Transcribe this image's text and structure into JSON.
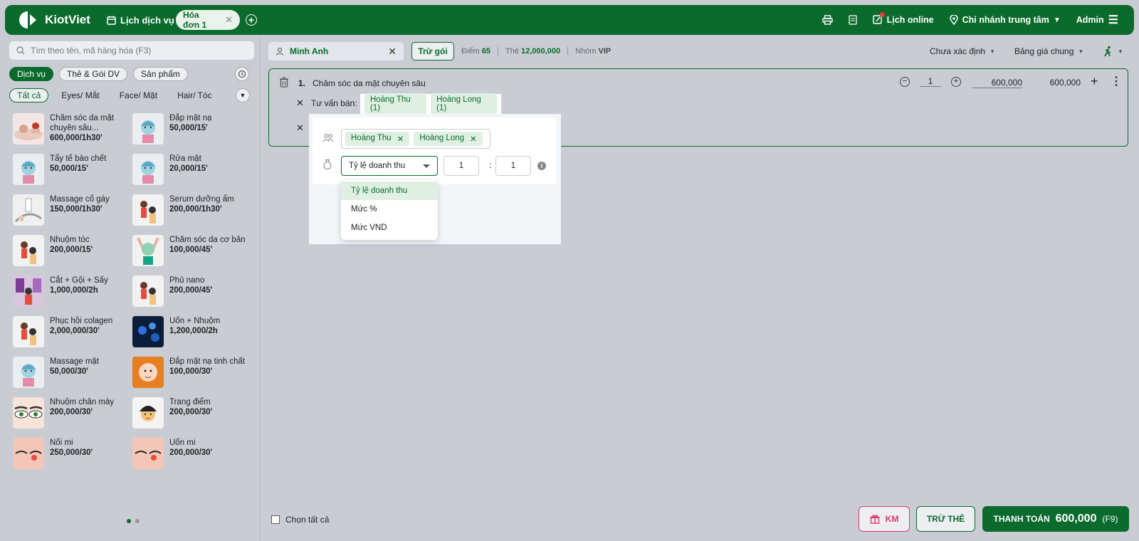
{
  "app": {
    "name": "KiotViet"
  },
  "topbar": {
    "schedule_label": "Lịch dịch vụ",
    "tab_label": "Hóa đơn 1",
    "online_label": "Lịch online",
    "branch_label": "Chi nhánh trung tâm",
    "user_label": "Admin"
  },
  "colors": {
    "brand": "#0a6b2c",
    "accent_pink": "#d63b6f",
    "tag_bg": "#dff0e3"
  },
  "search": {
    "placeholder": "Tìm theo tên, mã hàng hóa (F3)"
  },
  "categories": [
    "Dịch vụ",
    "Thẻ & Gói DV",
    "Sản phẩm"
  ],
  "subcategories": [
    "Tất cả",
    "Eyes/ Mắt",
    "Face/ Mặt",
    "Hair/ Tóc"
  ],
  "products": [
    {
      "name": "Chăm sóc da mặt chuyên sâu...",
      "price": "600,000/1h30'",
      "thumb": "massage"
    },
    {
      "name": "Đắp mặt nạ",
      "price": "50,000/15'",
      "thumb": "mask"
    },
    {
      "name": "Tẩy tế bào chết",
      "price": "50,000/15'",
      "thumb": "mask"
    },
    {
      "name": "Rửa mặt",
      "price": "20,000/15'",
      "thumb": "mask"
    },
    {
      "name": "Massage cổ gáy",
      "price": "150,000/1h30'",
      "thumb": "neck"
    },
    {
      "name": "Serum dưỡng ẩm",
      "price": "200,000/1h30'",
      "thumb": "hair"
    },
    {
      "name": "Nhuộm tóc",
      "price": "200,000/15'",
      "thumb": "hair"
    },
    {
      "name": "Chăm sóc da cơ bản",
      "price": "100,000/45'",
      "thumb": "face"
    },
    {
      "name": "Cắt + Gội + Sấy",
      "price": "1,000,000/2h",
      "thumb": "salon"
    },
    {
      "name": "Phủ nano",
      "price": "200,000/45'",
      "thumb": "hair"
    },
    {
      "name": "Phục hồi colagen",
      "price": "2,000,000/30'",
      "thumb": "hair"
    },
    {
      "name": "Uốn + Nhuộm",
      "price": "1,200,000/2h",
      "thumb": "blue"
    },
    {
      "name": "Massage mặt",
      "price": "50,000/30'",
      "thumb": "mask"
    },
    {
      "name": "Đắp mặt nạ tinh chất",
      "price": "100,000/30'",
      "thumb": "orange"
    },
    {
      "name": "Nhuộm chân mày",
      "price": "200,000/30'",
      "thumb": "eyes"
    },
    {
      "name": "Trang điểm",
      "price": "200,000/30'",
      "thumb": "makeup"
    },
    {
      "name": "Nối mi",
      "price": "250,000/30'",
      "thumb": "lash"
    },
    {
      "name": "Uốn mi",
      "price": "200,000/30'",
      "thumb": "lash"
    }
  ],
  "customer": {
    "name": "Minh Anh",
    "tru_goi": "Trừ gói",
    "diem_label": "Điểm",
    "diem": "65",
    "the_label": "Thẻ",
    "the": "12,000,000",
    "nhom_label": "Nhóm",
    "nhom": "VIP"
  },
  "right_selects": {
    "status": "Chưa xác định",
    "price_list": "Bảng giá chung"
  },
  "line": {
    "index": "1.",
    "name": "Chăm sóc da mặt chuyên sâu",
    "qty": "1",
    "price": "600,000",
    "total": "600,000"
  },
  "advisor": {
    "label": "Tư vấn bán:",
    "tags": [
      "Hoàng Thu (1)",
      "Hoàng Long (1)"
    ]
  },
  "popup": {
    "staff": [
      "Hoàng Thu",
      "Hoàng Long"
    ],
    "ratio_select": "Tỷ lệ doanh thu",
    "ratio_a": "1",
    "ratio_b": "1",
    "colon": ":"
  },
  "dropdown": {
    "options": [
      "Tỷ lệ doanh thu",
      "Mức %",
      "Mức VND"
    ]
  },
  "footer": {
    "select_all": "Chọn tất cả",
    "km": "KM",
    "tru_the": "TRỪ THẺ",
    "pay_label": "THANH TOÁN",
    "pay_amount": "600,000",
    "pay_key": "(F9)"
  }
}
